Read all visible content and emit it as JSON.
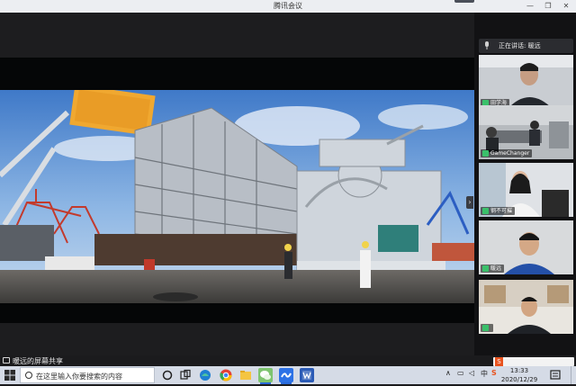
{
  "window": {
    "title": "腾讯会议",
    "minimize_glyph": "—",
    "maximize_glyph": "❐",
    "close_glyph": "✕"
  },
  "sidebar": {
    "speaking_label": "正在讲话: 暖远",
    "collapse_glyph": "›",
    "participants": [
      {
        "name": "田学海"
      },
      {
        "name": "GameChanger"
      },
      {
        "name": "钢不可摧"
      },
      {
        "name": "暖远"
      },
      {
        "name": ""
      }
    ]
  },
  "share_bar": {
    "label": "暖远的屏幕共享"
  },
  "taskbar": {
    "search_placeholder": "在这里输入你要搜索的内容",
    "tray": {
      "ime": "中",
      "ime_icon": "S"
    },
    "time": "13:33",
    "date": "2020/12/29"
  },
  "colors": {
    "accent_green": "#3ac06a",
    "taskbar_bg": "#d5dbe6",
    "sogou_orange": "#e8531f"
  }
}
